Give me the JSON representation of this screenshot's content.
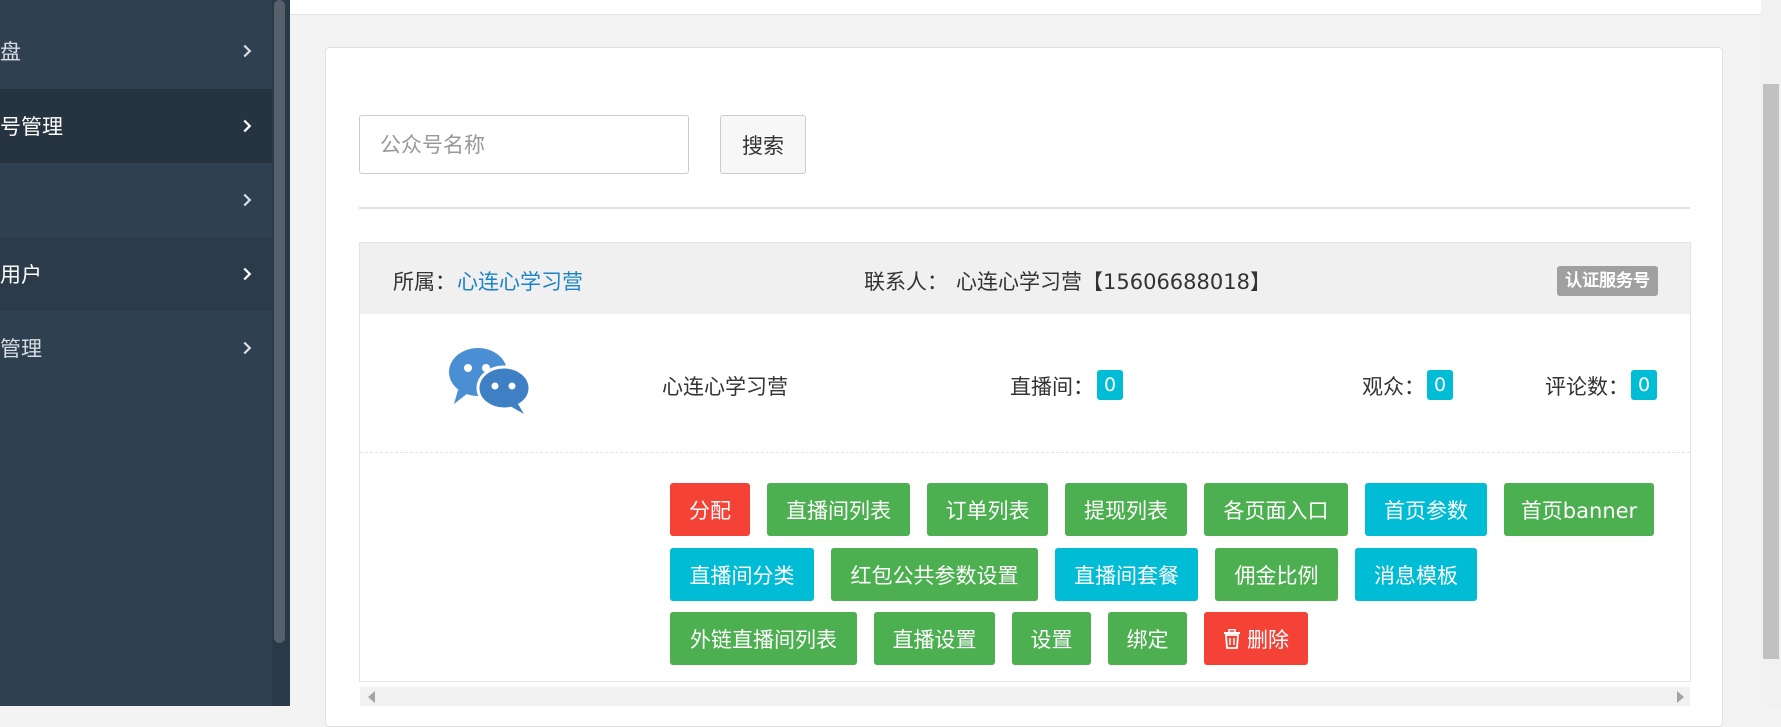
{
  "sidebar": {
    "items": [
      {
        "label": "盘"
      },
      {
        "label": "号管理"
      },
      {
        "label": ""
      },
      {
        "label": "用户"
      },
      {
        "label": "管理"
      }
    ]
  },
  "search": {
    "placeholder": "公众号名称",
    "button_label": "搜索"
  },
  "account": {
    "owner_label": "所属：",
    "owner_value": "心连心学习营",
    "contact_label": "联系人：",
    "contact_value": "心连心学习营【15606688018】",
    "type_badge": "认证服务号",
    "name": "心连心学习营",
    "live_rooms_label": "直播间：",
    "live_rooms_count": "0",
    "audience_label": "观众：",
    "audience_count": "0",
    "comments_label": "评论数：",
    "comments_count": "0"
  },
  "actions": {
    "assign": "分配",
    "live_room_list": "直播间列表",
    "order_list": "订单列表",
    "withdraw_list": "提现列表",
    "page_entries": "各页面入口",
    "home_params": "首页参数",
    "home_banner": "首页banner",
    "live_room_category": "直播间分类",
    "red_packet_params": "红包公共参数设置",
    "live_room_package": "直播间套餐",
    "commission_ratio": "佣金比例",
    "message_template": "消息模板",
    "external_live_room_list": "外链直播间列表",
    "live_settings": "直播设置",
    "settings": "设置",
    "bind": "绑定",
    "delete": "删除"
  },
  "colors": {
    "sidebar_bg": "#2f4050",
    "danger": "#f44336",
    "success": "#4caf50",
    "info": "#00bcd4",
    "link": "#1c84c6"
  }
}
